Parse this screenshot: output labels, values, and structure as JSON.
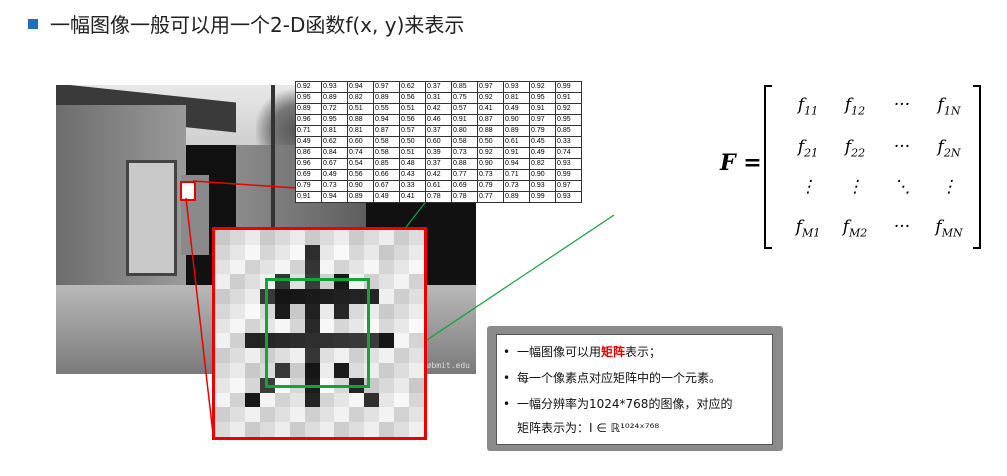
{
  "heading": "一幅图像一般可以用一个2-D函数f(x, y)来表示",
  "photo_credit": "© philjøbmit.edu",
  "matrix_rows": [
    [
      "0.92",
      "0.93",
      "0.94",
      "0.97",
      "0.62",
      "0.37",
      "0.85",
      "0.97",
      "0.93",
      "0.92",
      "0.99"
    ],
    [
      "0.95",
      "0.89",
      "0.82",
      "0.89",
      "0.56",
      "0.31",
      "0.75",
      "0.92",
      "0.81",
      "0.95",
      "0.91"
    ],
    [
      "0.89",
      "0.72",
      "0.51",
      "0.55",
      "0.51",
      "0.42",
      "0.57",
      "0.41",
      "0.49",
      "0.91",
      "0.92"
    ],
    [
      "0.96",
      "0.95",
      "0.88",
      "0.94",
      "0.56",
      "0.46",
      "0.91",
      "0.87",
      "0.90",
      "0.97",
      "0.95"
    ],
    [
      "0.71",
      "0.81",
      "0.81",
      "0.87",
      "0.57",
      "0.37",
      "0.80",
      "0.88",
      "0.89",
      "0.79",
      "0.85"
    ],
    [
      "0.49",
      "0.62",
      "0.60",
      "0.58",
      "0.50",
      "0.60",
      "0.58",
      "0.50",
      "0.61",
      "0.45",
      "0.33"
    ],
    [
      "0.86",
      "0.84",
      "0.74",
      "0.58",
      "0.51",
      "0.39",
      "0.73",
      "0.92",
      "0.91",
      "0.49",
      "0.74"
    ],
    [
      "0.96",
      "0.67",
      "0.54",
      "0.85",
      "0.48",
      "0.37",
      "0.88",
      "0.90",
      "0.94",
      "0.82",
      "0.93"
    ],
    [
      "0.69",
      "0.49",
      "0.56",
      "0.66",
      "0.43",
      "0.42",
      "0.77",
      "0.73",
      "0.71",
      "0.90",
      "0.99"
    ],
    [
      "0.79",
      "0.73",
      "0.90",
      "0.67",
      "0.33",
      "0.61",
      "0.69",
      "0.79",
      "0.73",
      "0.93",
      "0.97"
    ],
    [
      "0.91",
      "0.94",
      "0.89",
      "0.49",
      "0.41",
      "0.78",
      "0.78",
      "0.77",
      "0.89",
      "0.99",
      "0.93"
    ]
  ],
  "formula": {
    "lhs": "F =",
    "cells": [
      [
        "f11",
        "f12",
        "···",
        "f1N"
      ],
      [
        "f21",
        "f22",
        "···",
        "f2N"
      ],
      [
        "⋮",
        "⋮",
        "⋱",
        "⋮"
      ],
      [
        "fM1",
        "fM2",
        "···",
        "fMN"
      ]
    ]
  },
  "info": {
    "item1_pre": "一幅图像可以用",
    "item1_highlight": "矩阵",
    "item1_post": "表示；",
    "item2": "每一个像素点对应矩阵中的一个元素。",
    "item3_line1": "一幅分辨率为1024*768的图像，对应的",
    "item3_line2": "矩阵表示为：I ∈ ℝ¹⁰²⁴ˣ⁷⁶⁸"
  },
  "colors": {
    "accent": "#1f6fbf",
    "red": "#e00000",
    "green": "#12a33a"
  }
}
